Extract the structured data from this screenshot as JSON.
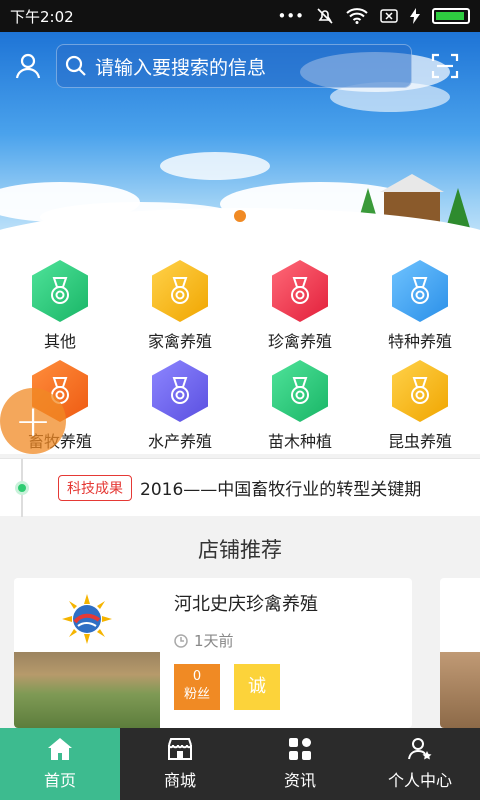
{
  "status_bar": {
    "time": "下午2:02"
  },
  "search": {
    "placeholder": "请输入要搜索的信息"
  },
  "banner": {
    "dots": 3,
    "active_dot": 1
  },
  "categories": [
    {
      "label": "其他",
      "color": "#2ecc71"
    },
    {
      "label": "家禽养殖",
      "color": "#f5b400"
    },
    {
      "label": "珍禽养殖",
      "color": "#ef3d4f"
    },
    {
      "label": "特种养殖",
      "color": "#3fa3f0"
    },
    {
      "label": "畜牧养殖",
      "color": "#f26b21"
    },
    {
      "label": "水产养殖",
      "color": "#6c63e6"
    },
    {
      "label": "苗木种植",
      "color": "#2ecc71"
    },
    {
      "label": "昆虫养殖",
      "color": "#f5b400"
    }
  ],
  "ticker": {
    "tag": "科技成果",
    "text": "2016——中国畜牧行业的转型关键期"
  },
  "shops": {
    "section_title": "店铺推荐",
    "items": [
      {
        "name": "河北史庆珍禽养殖",
        "time": "1天前",
        "fans_count": "0",
        "fans_label": "粉丝",
        "badge": "诚"
      }
    ]
  },
  "bottom_nav": [
    {
      "label": "首页",
      "icon": "home-icon",
      "active": true
    },
    {
      "label": "商城",
      "icon": "shop-icon",
      "active": false
    },
    {
      "label": "资讯",
      "icon": "grid-icon",
      "active": false
    },
    {
      "label": "个人中心",
      "icon": "profile-icon",
      "active": false
    }
  ],
  "colors": {
    "accent": "#3dbb8f",
    "orange": "#f08a24",
    "nav_bg": "#2b2b2b"
  }
}
